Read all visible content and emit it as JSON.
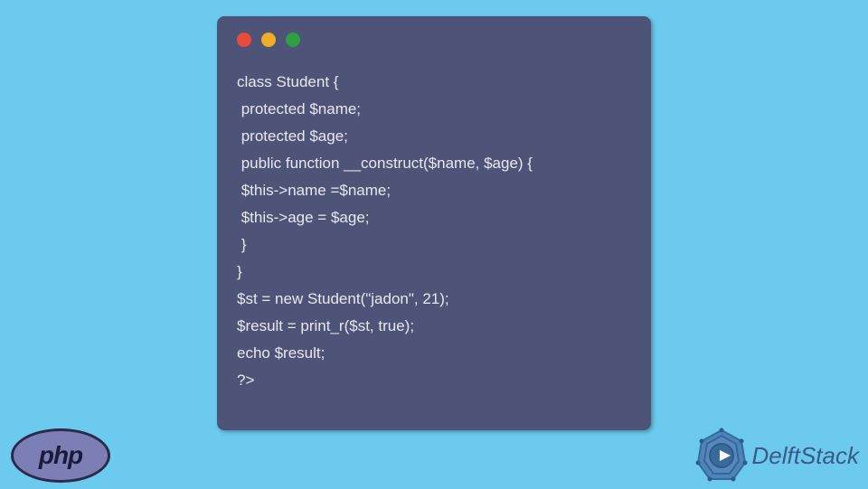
{
  "code": {
    "lines": [
      "class Student {",
      " protected $name;",
      " protected $age;",
      " public function __construct($name, $age) {",
      " $this->name =$name;",
      " $this->age = $age;",
      " }",
      "}",
      "$st = new Student(\"jadon\", 21);",
      "$result = print_r($st, true);",
      "echo $result;",
      "?>"
    ]
  },
  "php_logo": {
    "text": "php"
  },
  "delft_logo": {
    "text": "DelftStack"
  }
}
